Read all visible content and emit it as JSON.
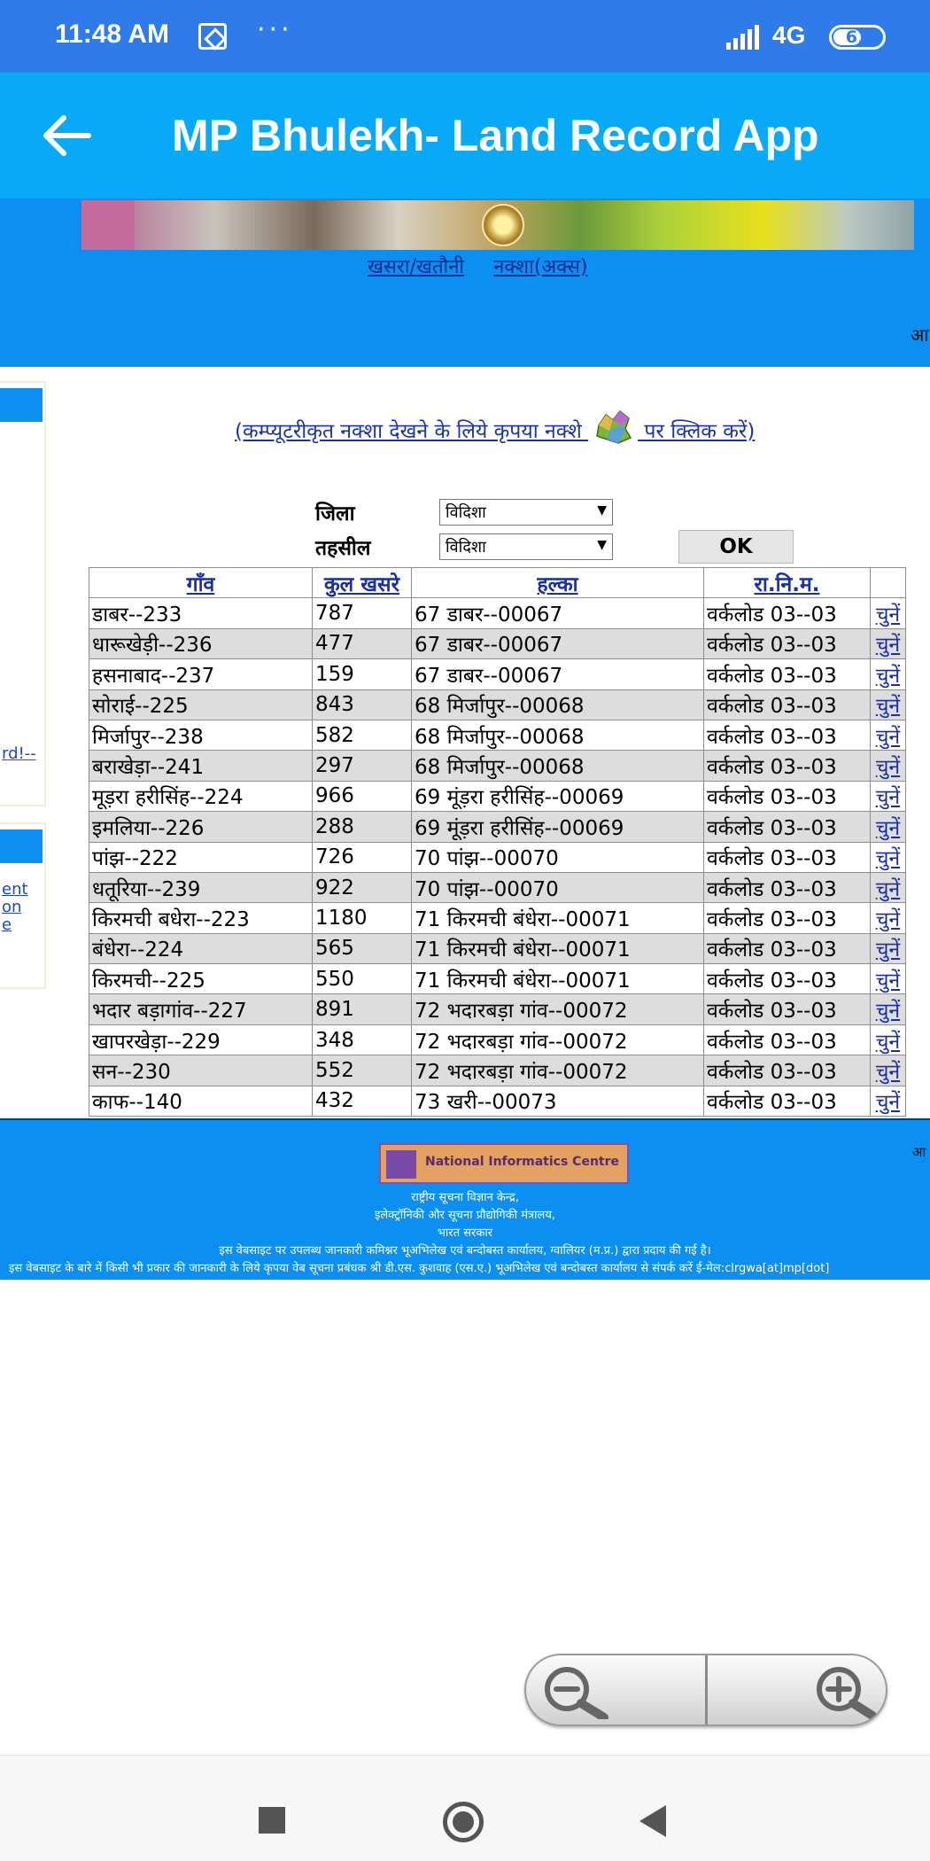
{
  "status_bar": {
    "time": "11:48 AM",
    "overflow": "···",
    "network": "4G",
    "battery_level": "61"
  },
  "app_bar": {
    "title": "MP Bhulekh- Land Record App"
  },
  "top_links": {
    "khasra": "खसरा/खतौनी",
    "naksha": "नक्शा(अक्स)"
  },
  "edge_text": "आ",
  "side_link_1": "rd!--",
  "side_link_2": [
    "ent",
    "on",
    "e"
  ],
  "map_link": {
    "before": "(कम्प्यूटरीकृत नक्शा देखने के लिये कृपया नक्शे ",
    "after": " पर क्लिक करें)"
  },
  "form": {
    "district_label": "जिला",
    "district_value": "विदिशा",
    "tehsil_label": "तहसील",
    "tehsil_value": "विदिशा",
    "ok_label": "OK"
  },
  "table": {
    "headers": [
      "गाँव",
      "कुल खसरे",
      "हल्का",
      "रा.नि.म.",
      ""
    ],
    "select_label": "चुनें",
    "rows": [
      [
        "डाबर--233",
        "787",
        "67 डाबर--00067",
        "वर्कलोड 03--03"
      ],
      [
        "धारूखेड़ी--236",
        "477",
        "67 डाबर--00067",
        "वर्कलोड 03--03"
      ],
      [
        "हसनाबाद--237",
        "159",
        "67 डाबर--00067",
        "वर्कलोड 03--03"
      ],
      [
        "सोराई--225",
        "843",
        "68 मिर्जापुर--00068",
        "वर्कलोड 03--03"
      ],
      [
        "मिर्जापुर--238",
        "582",
        "68 मिर्जापुर--00068",
        "वर्कलोड 03--03"
      ],
      [
        "बराखेड़ा--241",
        "297",
        "68 मिर्जापुर--00068",
        "वर्कलोड 03--03"
      ],
      [
        "मूड़रा हरीसिंह--224",
        "966",
        "69 मूंड़रा हरीसिंह--00069",
        "वर्कलोड 03--03"
      ],
      [
        "इमलिया--226",
        "288",
        "69 मूंड़रा हरीसिंह--00069",
        "वर्कलोड 03--03"
      ],
      [
        "पांझ--222",
        "726",
        "70 पांझ--00070",
        "वर्कलोड 03--03"
      ],
      [
        "धतूरिया--239",
        "922",
        "70 पांझ--00070",
        "वर्कलोड 03--03"
      ],
      [
        "किरमची बधेरा--223",
        "1180",
        "71 किरमची बंधेरा--00071",
        "वर्कलोड 03--03"
      ],
      [
        "बंधेरा--224",
        "565",
        "71 किरमची बंधेरा--00071",
        "वर्कलोड 03--03"
      ],
      [
        "किरमची--225",
        "550",
        "71 किरमची बंधेरा--00071",
        "वर्कलोड 03--03"
      ],
      [
        "भदार बड़ागांव--227",
        "891",
        "72 भदारबड़ा गांव--00072",
        "वर्कलोड 03--03"
      ],
      [
        "खापरखेड़ा--229",
        "348",
        "72 भदारबड़ा गांव--00072",
        "वर्कलोड 03--03"
      ],
      [
        "सन--230",
        "552",
        "72 भदारबड़ा गांव--00072",
        "वर्कलोड 03--03"
      ],
      [
        "काफ--140",
        "432",
        "73 खरी--00073",
        "वर्कलोड 03--03"
      ]
    ]
  },
  "footer": {
    "logo_text": "National Informatics Centre",
    "edge_text": "आ",
    "lines": [
      "राष्ट्रीय सूचना विज्ञान केन्द्र,",
      "इलेक्ट्रॉनिकी और सूचना प्रौद्योगिकी मंत्रालय,",
      "भारत सरकार",
      "इस वेबसाइट पर उपलब्ध जानकारी कमिश्नर भूअभिलेख एवं बन्दोबस्त कार्यालय, ग्वालियर (म.प्र.) द्वारा प्रदाय की गई है।",
      "इस वेबसाइट के बारे में किसी भी प्रकार की जानकारी के लिये कृपया वेब सूचना प्रबंधक श्री डी.एस. कुशवाह (एस.ए.) भूअभिलेख एवं बन्दोबस्त कार्यालय से संपर्क करें ई-मेल:clrgwa[at]mp[dot]"
    ]
  },
  "colors": {
    "status_bar": "#2f7bea",
    "app_bar": "#08aaf5",
    "web_blue": "#0b8ff1",
    "link": "#1a2fa0",
    "row_alt": "#dddddd"
  },
  "icons": {
    "back": "back-arrow-icon",
    "zoom_out": "zoom-out-icon",
    "zoom_in": "zoom-in-icon",
    "nav_recents": "recents-square-icon",
    "nav_home": "home-circle-icon",
    "nav_back": "back-triangle-icon"
  }
}
